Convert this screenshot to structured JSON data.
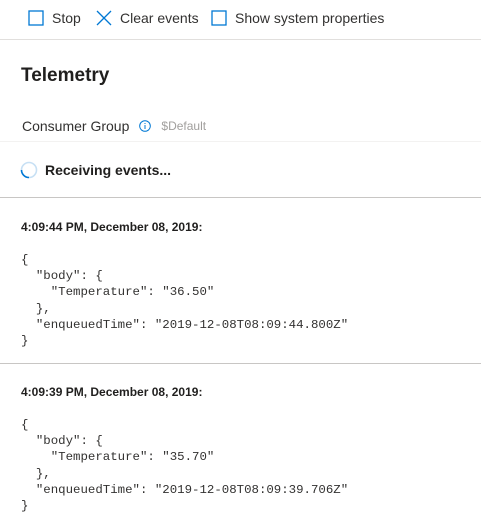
{
  "toolbar": {
    "stop_label": "Stop",
    "clear_label": "Clear events",
    "show_props_label": "Show system properties"
  },
  "title": "Telemetry",
  "consumer_group": {
    "label": "Consumer Group",
    "placeholder": "$Default"
  },
  "status": {
    "text": "Receiving events..."
  },
  "events": [
    {
      "time": "4:09:44 PM, December 08, 2019:",
      "json": "{\n  \"body\": {\n    \"Temperature\": \"36.50\"\n  },\n  \"enqueuedTime\": \"2019-12-08T08:09:44.800Z\"\n}"
    },
    {
      "time": "4:09:39 PM, December 08, 2019:",
      "json": "{\n  \"body\": {\n    \"Temperature\": \"35.70\"\n  },\n  \"enqueuedTime\": \"2019-12-08T08:09:39.706Z\"\n}"
    }
  ],
  "colors": {
    "accent": "#0078d4",
    "text": "#323130",
    "placeholder": "#a19f9d",
    "separator": "#c8c6c4"
  },
  "icons": {
    "stop": "checkbox-square-icon",
    "clear": "close-x-icon",
    "show_props": "checkbox-square-icon",
    "info": "info-icon",
    "status": "spinner-icon"
  }
}
